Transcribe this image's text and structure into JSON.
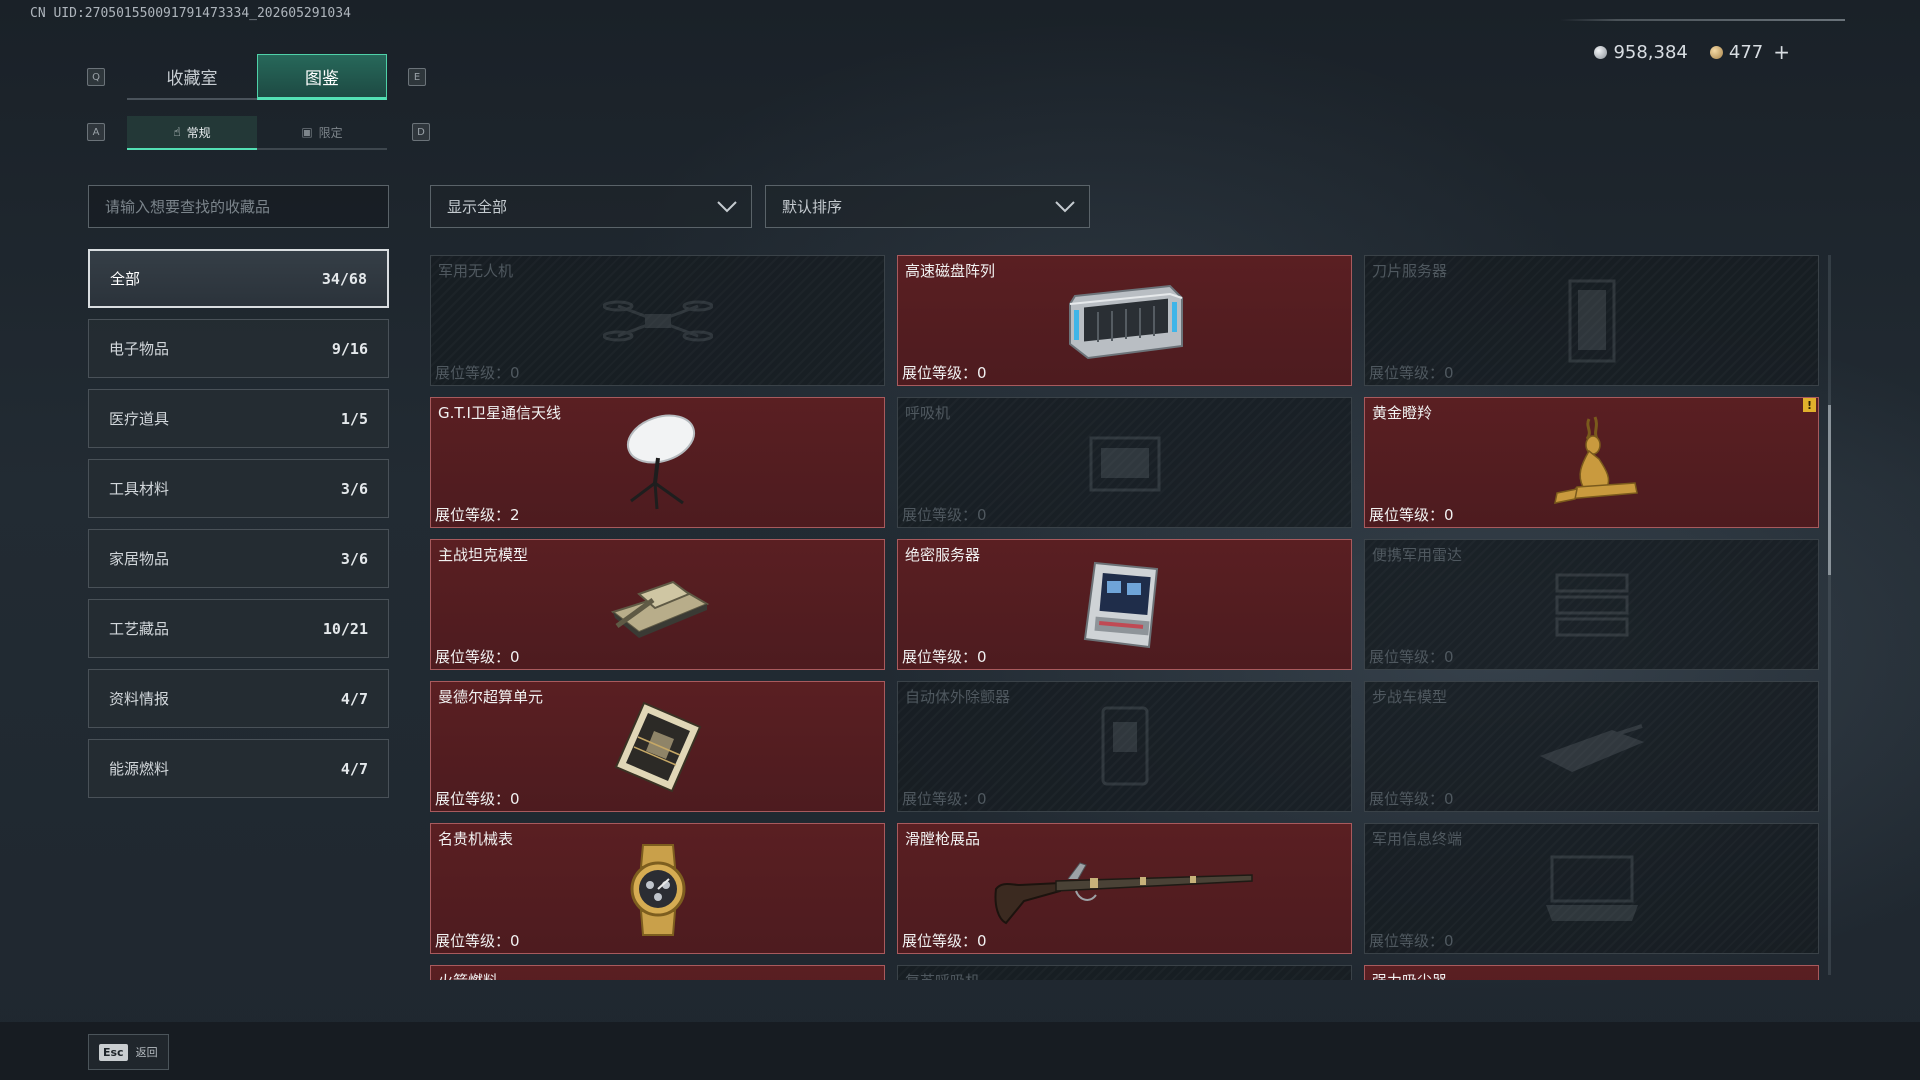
{
  "header": {
    "uid": "CN UID:270501550091791473334_202605291034",
    "currency": [
      {
        "icon": "silver-coin-icon",
        "value": "958,384"
      },
      {
        "icon": "gold-coin-icon",
        "value": "477"
      }
    ],
    "plus": "+"
  },
  "keys": {
    "q": "Q",
    "e": "E",
    "a": "A",
    "d": "D"
  },
  "tabs": [
    {
      "label": "收藏室",
      "active": false
    },
    {
      "label": "图鉴",
      "active": true
    }
  ],
  "subtabs": [
    {
      "label": "常规",
      "icon": "hand-icon",
      "active": true
    },
    {
      "label": "限定",
      "icon": "limited-icon",
      "active": false
    }
  ],
  "search": {
    "placeholder": "请输入想要查找的收藏品"
  },
  "filters": {
    "show": "显示全部",
    "sort": "默认排序"
  },
  "categories": [
    {
      "label": "全部",
      "count": "34/68"
    },
    {
      "label": "电子物品",
      "count": "9/16"
    },
    {
      "label": "医疗道具",
      "count": "1/5"
    },
    {
      "label": "工具材料",
      "count": "3/6"
    },
    {
      "label": "家居物品",
      "count": "3/6"
    },
    {
      "label": "工艺藏品",
      "count": "10/21"
    },
    {
      "label": "资料情报",
      "count": "4/7"
    },
    {
      "label": "能源燃料",
      "count": "4/7"
    }
  ],
  "items": [
    {
      "name": "军用无人机",
      "level": "展位等级：0",
      "owned": false,
      "icon": "drone-icon"
    },
    {
      "name": "高速磁盘阵列",
      "level": "展位等级：0",
      "owned": true,
      "icon": "disk-array-icon"
    },
    {
      "name": "刀片服务器",
      "level": "展位等级：0",
      "owned": false,
      "icon": "blade-server-icon"
    },
    {
      "name": "G.T.I卫星通信天线",
      "level": "展位等级：2",
      "owned": true,
      "icon": "satellite-dish-icon"
    },
    {
      "name": "呼吸机",
      "level": "展位等级：0",
      "owned": false,
      "icon": "ventilator-icon"
    },
    {
      "name": "黄金瞪羚",
      "level": "展位等级：0",
      "owned": true,
      "icon": "golden-gazelle-icon",
      "alert": "!"
    },
    {
      "name": "主战坦克模型",
      "level": "展位等级：0",
      "owned": true,
      "icon": "tank-model-icon"
    },
    {
      "name": "绝密服务器",
      "level": "展位等级：0",
      "owned": true,
      "icon": "server-icon"
    },
    {
      "name": "便携军用雷达",
      "level": "展位等级：0",
      "owned": false,
      "icon": "radar-icon"
    },
    {
      "name": "曼德尔超算单元",
      "level": "展位等级：0",
      "owned": true,
      "icon": "supercomputer-unit-icon"
    },
    {
      "name": "自动体外除颤器",
      "level": "展位等级：0",
      "owned": false,
      "icon": "defibrillator-icon"
    },
    {
      "name": "步战车模型",
      "level": "展位等级：0",
      "owned": false,
      "icon": "ifv-model-icon"
    },
    {
      "name": "名贵机械表",
      "level": "展位等级：0",
      "owned": true,
      "icon": "watch-icon"
    },
    {
      "name": "滑膛枪展品",
      "level": "展位等级：0",
      "owned": true,
      "icon": "musket-icon"
    },
    {
      "name": "军用信息终端",
      "level": "展位等级：0",
      "owned": false,
      "icon": "terminal-icon"
    },
    {
      "name": "火箭燃料",
      "level": "",
      "owned": true,
      "icon": ""
    },
    {
      "name": "复苏呼吸机",
      "level": "",
      "owned": false,
      "icon": ""
    },
    {
      "name": "强力吸尘器",
      "level": "",
      "owned": true,
      "icon": ""
    }
  ],
  "footer": {
    "key": "Esc",
    "label": "返回"
  }
}
